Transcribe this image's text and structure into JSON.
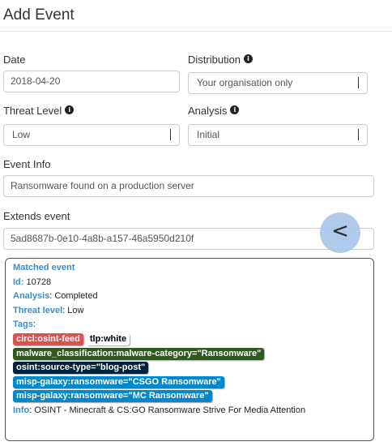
{
  "page": {
    "title": "Add Event"
  },
  "form": {
    "date": {
      "label": "Date",
      "value": "2018-04-20"
    },
    "distribution": {
      "label": "Distribution",
      "value": "Your organisation only"
    },
    "threat_level": {
      "label": "Threat Level",
      "value": "Low"
    },
    "analysis": {
      "label": "Analysis",
      "value": "Initial"
    },
    "event_info": {
      "label": "Event Info",
      "value": "Ransomware found on a production server"
    },
    "extends_event": {
      "label": "Extends event",
      "value": "5ad8687b-0e10-4a8b-a157-46a5950d210f"
    },
    "info_icon_glyph": "i",
    "back_button_glyph": "<"
  },
  "matched_event": {
    "heading": "Matched event",
    "id_label": "Id",
    "id_value": "10728",
    "analysis_label": "Analysis",
    "analysis_value": "Completed",
    "threat_label": "Threat level",
    "threat_value": "Low",
    "tags_label": "Tags",
    "tags": [
      {
        "text": "circl:osint-feed",
        "bg": "#d9534f",
        "fg": "#ffffff"
      },
      {
        "text": "tlp:white",
        "bg": "#ffffff",
        "fg": "#000000"
      },
      {
        "text": "malware_classification:malware-category=\"Ransomware\"",
        "bg": "#2e5b1d",
        "fg": "#ffffff"
      },
      {
        "text": "osint:source-type=\"blog-post\"",
        "bg": "#00223b",
        "fg": "#ffffff"
      },
      {
        "text": "misp-galaxy:ransomware=\"CSGO Ransomware\"",
        "bg": "#0088cc",
        "fg": "#ffffff"
      },
      {
        "text": "misp-galaxy:ransomware=\"MC Ransomware\"",
        "bg": "#0088cc",
        "fg": "#ffffff"
      }
    ],
    "info_label": "Info",
    "info_value": "OSINT - Minecraft & CS:GO Ransomware Strive For Media Attention"
  }
}
